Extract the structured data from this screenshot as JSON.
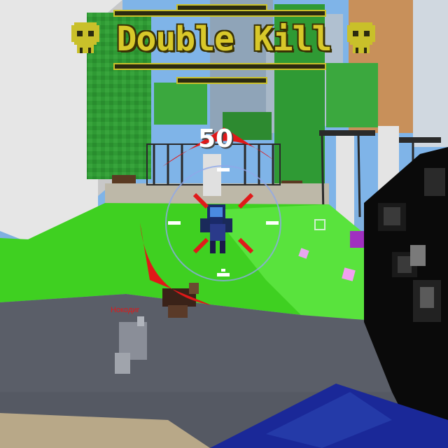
{
  "hud": {
    "kill_streak_label": "Double Kill",
    "score_popup": "50",
    "player_nametag": "Нoкoдиr",
    "enemy_nametag": ""
  },
  "colors": {
    "banner_text": "#d8c82a",
    "crosshair_red": "#e01a1a",
    "crosshair_ring": "#8fa8e8",
    "grass": "#3fd021"
  },
  "icons": {
    "banner_left": "skull-icon",
    "banner_right": "skull-icon",
    "crosshair": "crosshair-icon"
  }
}
